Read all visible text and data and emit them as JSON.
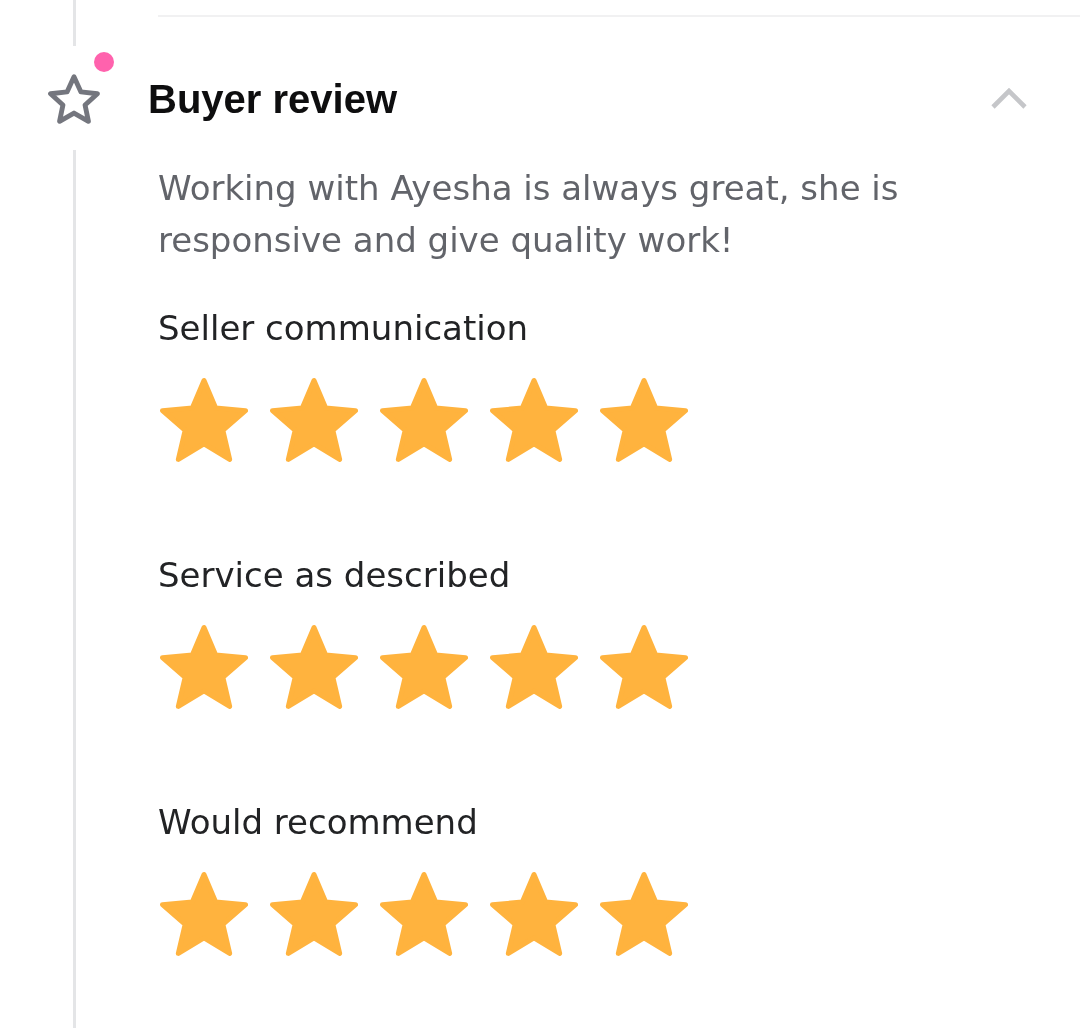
{
  "event": {
    "title": "Buyer review",
    "unread": true,
    "expanded": true,
    "review": "Working with Ayesha is always great, she is responsive and give quality work!",
    "ratings": [
      {
        "label": "Seller communication",
        "stars": 5
      },
      {
        "label": "Service as described",
        "stars": 5
      },
      {
        "label": "Would recommend",
        "stars": 5
      }
    ]
  }
}
